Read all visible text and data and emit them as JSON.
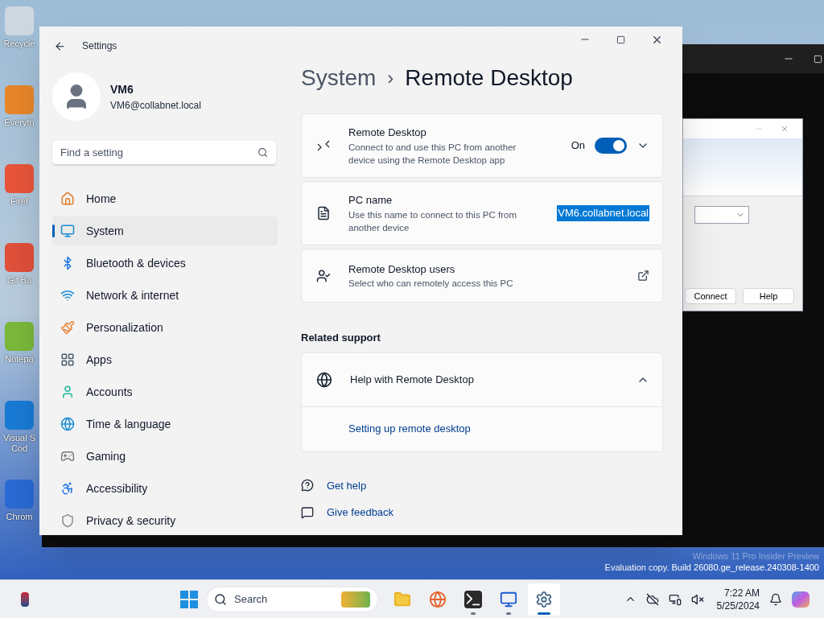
{
  "desktop_icons": [
    {
      "label": [
        "Recycle"
      ]
    },
    {
      "label": [
        "Everyth"
      ]
    },
    {
      "label": [
        "Firef"
      ]
    },
    {
      "label": [
        "Git Ba"
      ]
    },
    {
      "label": [
        "Notepa"
      ]
    },
    {
      "label": [
        "Visual S",
        "Cod"
      ]
    },
    {
      "label": [
        "Chrom"
      ]
    }
  ],
  "background_dialog": {
    "buttons": [
      "Connect",
      "Help"
    ]
  },
  "watermark": [
    "Windows 11 Pro Insider Preview",
    "Evaluation copy. Build 26080.ge_release.240308-1400"
  ],
  "window": {
    "title": "Settings"
  },
  "account": {
    "name": "VM6",
    "email": "VM6@collabnet.local"
  },
  "search": {
    "placeholder": "Find a setting"
  },
  "sidebar": {
    "items": [
      {
        "label": "Home",
        "selected": false
      },
      {
        "label": "System",
        "selected": true
      },
      {
        "label": "Bluetooth & devices",
        "selected": false
      },
      {
        "label": "Network & internet",
        "selected": false
      },
      {
        "label": "Personalization",
        "selected": false
      },
      {
        "label": "Apps",
        "selected": false
      },
      {
        "label": "Accounts",
        "selected": false
      },
      {
        "label": "Time & language",
        "selected": false
      },
      {
        "label": "Gaming",
        "selected": false
      },
      {
        "label": "Accessibility",
        "selected": false
      },
      {
        "label": "Privacy & security",
        "selected": false
      }
    ]
  },
  "breadcrumb": {
    "parent": "System",
    "separator": "›",
    "current": "Remote Desktop"
  },
  "settings": [
    {
      "kind": "toggle",
      "title": "Remote Desktop",
      "description": "Connect to and use this PC from another device using the Remote Desktop app",
      "state_label": "On",
      "on": true
    },
    {
      "kind": "value",
      "title": "PC name",
      "description": "Use this name to connect to this PC from another device",
      "value": "VM6.collabnet.local"
    },
    {
      "kind": "link",
      "title": "Remote Desktop users",
      "description": "Select who can remotely access this PC"
    }
  ],
  "related_support": {
    "heading": "Related support",
    "title": "Help with Remote Desktop",
    "expanded": true,
    "links": [
      "Setting up remote desktop"
    ]
  },
  "footer_links": [
    "Get help",
    "Give feedback"
  ],
  "taskbar": {
    "search_placeholder": "Search",
    "apps": [
      {
        "selected": false,
        "open": false
      },
      {
        "selected": false,
        "open": false
      },
      {
        "selected": false,
        "open": true
      },
      {
        "selected": false,
        "open": true
      },
      {
        "selected": true,
        "open": true
      }
    ],
    "time": "7:22 AM",
    "date": "5/25/2024"
  }
}
